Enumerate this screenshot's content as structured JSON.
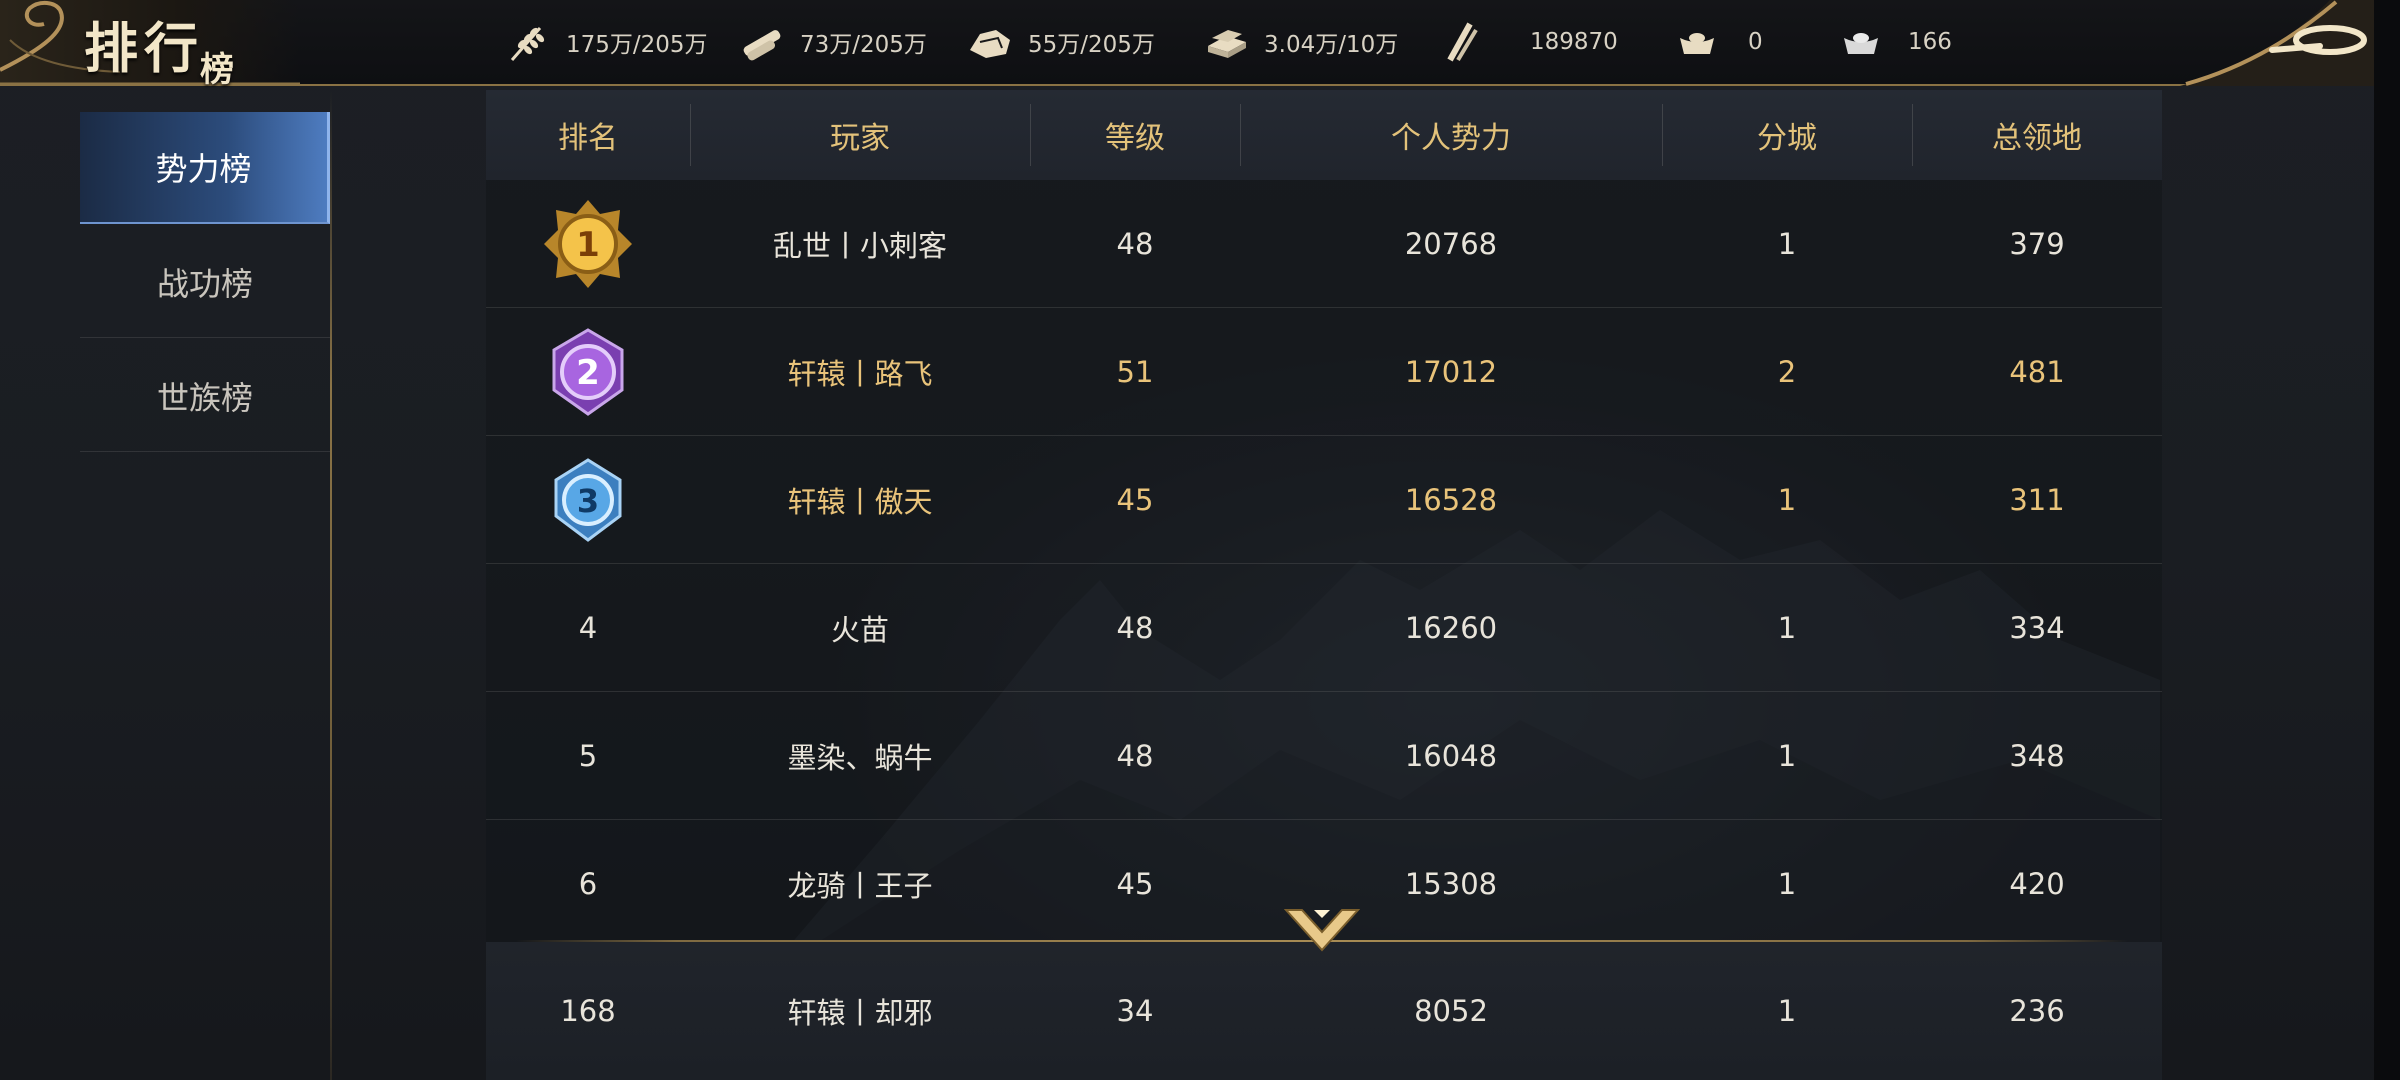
{
  "title": {
    "main": "排行",
    "sub": "榜"
  },
  "resources": [
    {
      "icon": "grain-icon",
      "value": "175万/205万"
    },
    {
      "icon": "wood-icon",
      "value": "73万/205万"
    },
    {
      "icon": "stone-icon",
      "value": "55万/205万"
    },
    {
      "icon": "iron-icon",
      "value": "3.04万/10万"
    },
    {
      "icon": "copper-coin-icon",
      "value": "189870"
    },
    {
      "icon": "gold-ingot-icon",
      "value": "0"
    },
    {
      "icon": "silver-ingot-icon",
      "value": "166"
    }
  ],
  "sidebar": {
    "items": [
      {
        "label": "势力榜",
        "active": true
      },
      {
        "label": "战功榜",
        "active": false
      },
      {
        "label": "世族榜",
        "active": false
      }
    ]
  },
  "table": {
    "headers": [
      "排名",
      "玩家",
      "等级",
      "个人势力",
      "分城",
      "总领地"
    ],
    "rows": [
      {
        "rank": "1",
        "player": "乱世丨小刺客",
        "level": "48",
        "power": "20768",
        "subcity": "1",
        "territory": "379",
        "medal": "gold"
      },
      {
        "rank": "2",
        "player": "轩辕丨路飞",
        "level": "51",
        "power": "17012",
        "subcity": "2",
        "territory": "481",
        "medal": "purple"
      },
      {
        "rank": "3",
        "player": "轩辕丨傲天",
        "level": "45",
        "power": "16528",
        "subcity": "1",
        "territory": "311",
        "medal": "blue"
      },
      {
        "rank": "4",
        "player": "火苗",
        "level": "48",
        "power": "16260",
        "subcity": "1",
        "territory": "334"
      },
      {
        "rank": "5",
        "player": "墨染、蜗牛",
        "level": "48",
        "power": "16048",
        "subcity": "1",
        "territory": "348"
      },
      {
        "rank": "6",
        "player": "龙骑丨王子",
        "level": "45",
        "power": "15308",
        "subcity": "1",
        "territory": "420"
      }
    ],
    "my_row": {
      "rank": "168",
      "player": "轩辕丨却邪",
      "level": "34",
      "power": "8052",
      "subcity": "1",
      "territory": "236"
    }
  },
  "colors": {
    "header_text": "#e3c27a",
    "gold_text": "#e9c37a",
    "active_tab": "#2c4c7c",
    "divider": "#a88c54"
  }
}
